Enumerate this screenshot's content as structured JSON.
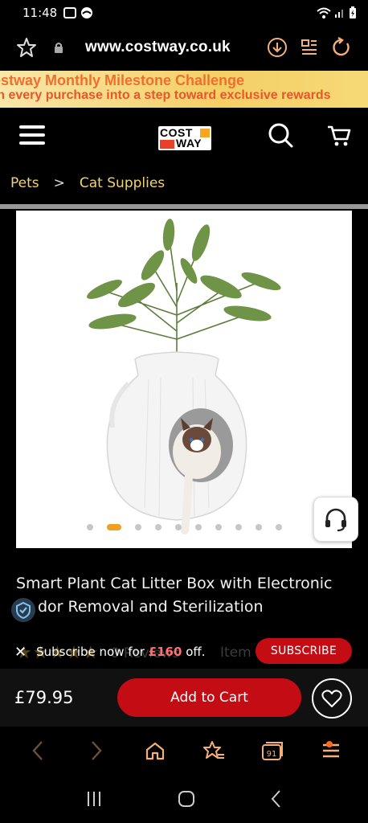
{
  "status_bar": {
    "time": "11:48"
  },
  "browser": {
    "url": "www.costway.co.uk"
  },
  "promo": {
    "line1": "ostway Monthly Milestone Challenge",
    "line2": "rn every purchase into a step toward exclusive rewards"
  },
  "site_header": {
    "logo_top": "COST",
    "logo_bottom": "WAY"
  },
  "breadcrumb": {
    "items": [
      "Pets",
      "Cat Supplies"
    ],
    "separator": ">"
  },
  "gallery": {
    "dot_count": 10,
    "active_index": 1
  },
  "product": {
    "title_line1": "Smart Plant Cat Litter Box with Electronic",
    "title_line2": "dor Removal and Sterilization",
    "rating_stars": "★★★★★",
    "reviews_text": "0 Reviews",
    "item_label": "Item"
  },
  "subscribe": {
    "text_before": "Subscribe now for ",
    "amount": "£160",
    "text_after": " off.",
    "button": "SUBSCRIBE"
  },
  "cart_bar": {
    "price": "£79.95",
    "add_to_cart": "Add to Cart"
  },
  "toolbar": {
    "tabs_count": "91"
  },
  "colors": {
    "accent_red": "#c30c13",
    "accent_orange": "#f3b07a",
    "breadcrumb_yellow": "#f2d36e"
  }
}
